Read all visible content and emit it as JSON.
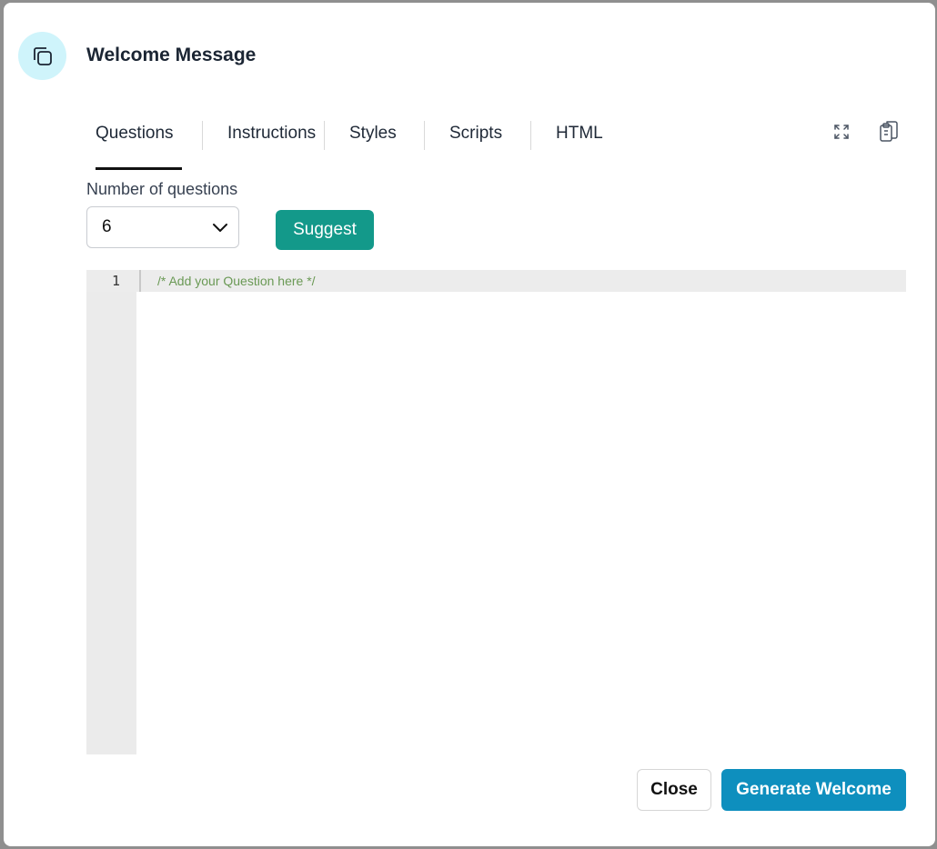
{
  "dialog": {
    "title": "Welcome Message",
    "header_icon": "copy-icon"
  },
  "tabs": [
    {
      "label": "Questions",
      "active": true
    },
    {
      "label": "Instructions",
      "active": false
    },
    {
      "label": "Styles",
      "active": false
    },
    {
      "label": "Scripts",
      "active": false
    },
    {
      "label": "HTML",
      "active": false
    }
  ],
  "toolbar": {
    "expand_icon": "expand-icon",
    "clipboard_icon": "clipboard-icon"
  },
  "questions": {
    "label": "Number of questions",
    "selected_value": "6",
    "suggest_label": "Suggest"
  },
  "editor": {
    "lines": [
      {
        "number": "1",
        "text": "/* Add your Question here */"
      }
    ]
  },
  "footer": {
    "close_label": "Close",
    "generate_label": "Generate Welcome"
  },
  "colors": {
    "accent_teal": "#13998a",
    "primary_blue": "#0e8fbe",
    "icon_bg": "#cff4fb",
    "comment_green": "#6a9955"
  }
}
